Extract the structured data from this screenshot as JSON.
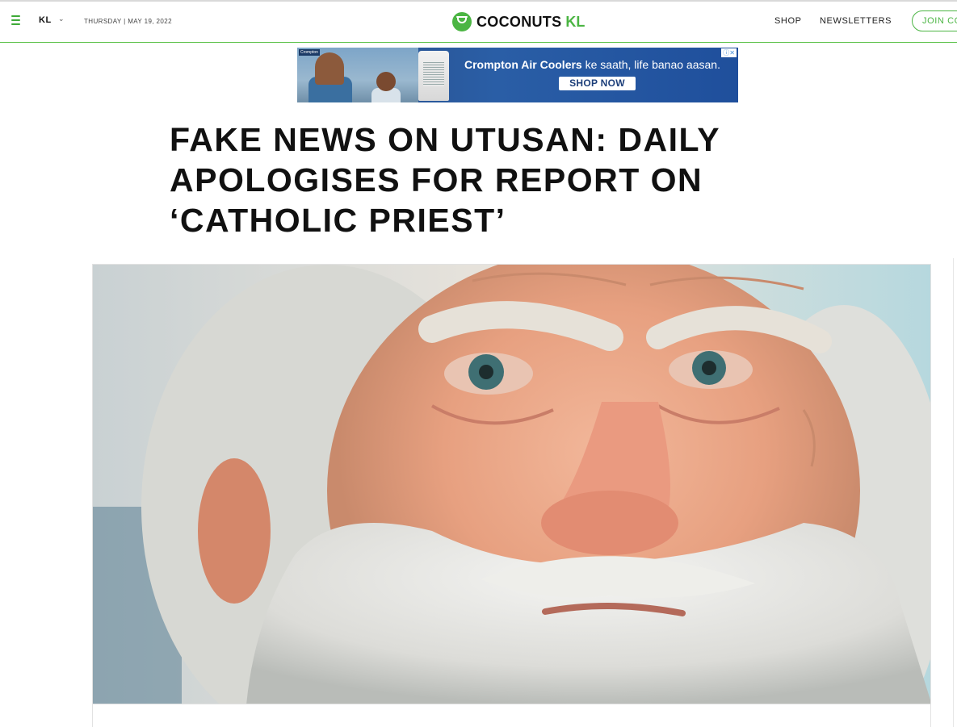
{
  "header": {
    "region": "KL",
    "date": "THURSDAY | MAY 19, 2022",
    "logo_text": "COCONUTS",
    "logo_region": "KL",
    "nav": {
      "shop": "SHOP",
      "newsletters": "NEWSLETTERS",
      "join": "JOIN COCONUTS+"
    }
  },
  "ad": {
    "brand_tag": "Crompton",
    "headline_bold": "Crompton Air Coolers",
    "headline_rest": " ke saath, life banao aasan.",
    "cta": "SHOP NOW",
    "close": "ⓘ✕"
  },
  "article": {
    "headline": "Fake News on Utusan: Daily Apologises for Report on ‘Catholic Priest’"
  },
  "colors": {
    "brand_green": "#4bb543",
    "ad_blue": "#2a5ea6",
    "text": "#111111"
  }
}
